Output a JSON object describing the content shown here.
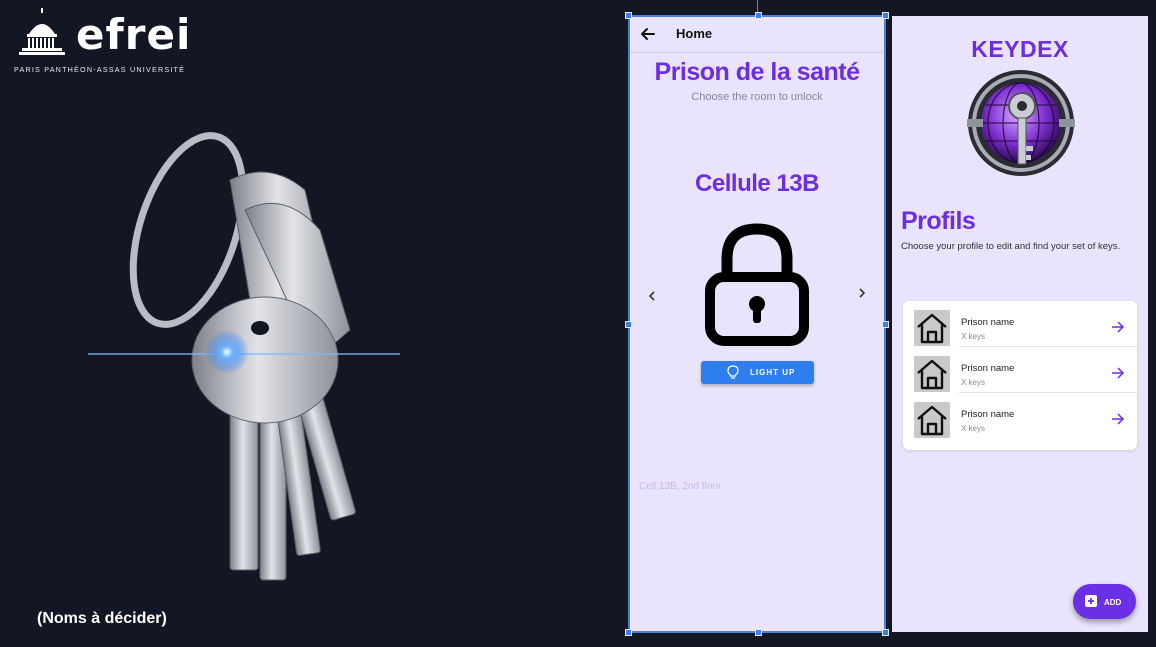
{
  "brand": {
    "logo_word": "efrei",
    "logo_subtitle": "PARIS PANTHÉON-ASSAS UNIVERSITÉ",
    "caption": "(Noms à décider)"
  },
  "colors": {
    "background": "#131724",
    "accent_purple": "#6c2ee0",
    "phone_bg": "#e9e4fb",
    "button_blue": "#2e7ef0",
    "selection_blue": "#4b82de"
  },
  "home_screen": {
    "header_title": "Home",
    "title": "Prison de la santé",
    "subtitle": "Choose the room to unlock",
    "cell_name": "Cellule 13B",
    "light_button": "LIGHT UP",
    "cell_description": "Cell 13B, 2nd floor.",
    "icons": [
      "back-arrow-icon",
      "chevron-left-icon",
      "chevron-right-icon",
      "padlock-icon",
      "lightbulb-icon"
    ]
  },
  "profiles_screen": {
    "app_name": "KEYDEX",
    "title": "Profils",
    "subtitle": "Choose your profile to edit and find your set of keys.",
    "items": [
      {
        "name": "Prison name",
        "keys": "X keys"
      },
      {
        "name": "Prison name",
        "keys": "X keys"
      },
      {
        "name": "Prison name",
        "keys": "X keys"
      }
    ],
    "add_button": "ADD",
    "icons": [
      "house-icon",
      "arrow-right-icon",
      "add-box-icon",
      "keydex-emblem-icon"
    ]
  }
}
